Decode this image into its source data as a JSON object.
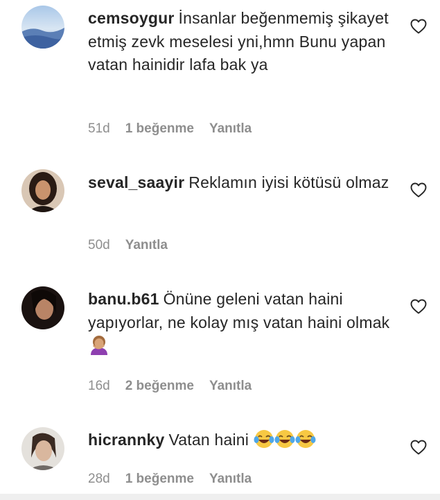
{
  "comments": [
    {
      "username": "cemsoygur",
      "text": "İnsanlar beğenmemiş şikayet etmiş zevk meselesi yni,hmn Bunu yapan vatan hainidir lafa bak ya",
      "age": "51d",
      "likes": "1 beğenme",
      "reply": "Yanıtla"
    },
    {
      "username": "seval_saayir",
      "text": "Reklamın iyisi kötüsü olmaz",
      "age": "50d",
      "likes": "",
      "reply": "Yanıtla"
    },
    {
      "username": "banu.b61",
      "text": "Önüne geleni vatan haini yapıyorlar, ne kolay mış vatan haini olmak",
      "emoji": "woman-facepalming",
      "age": "16d",
      "likes": "2 beğenme",
      "reply": "Yanıtla"
    },
    {
      "username": "hicrannky",
      "text": "Vatan haini",
      "emoji": "face-with-tears-of-joy x3",
      "age": "28d",
      "likes": "1 beğenme",
      "reply": "Yanıtla"
    }
  ],
  "icons": {
    "like": "heart-outline-icon"
  },
  "colors": {
    "text": "#262626",
    "meta": "#8e8e8e"
  }
}
